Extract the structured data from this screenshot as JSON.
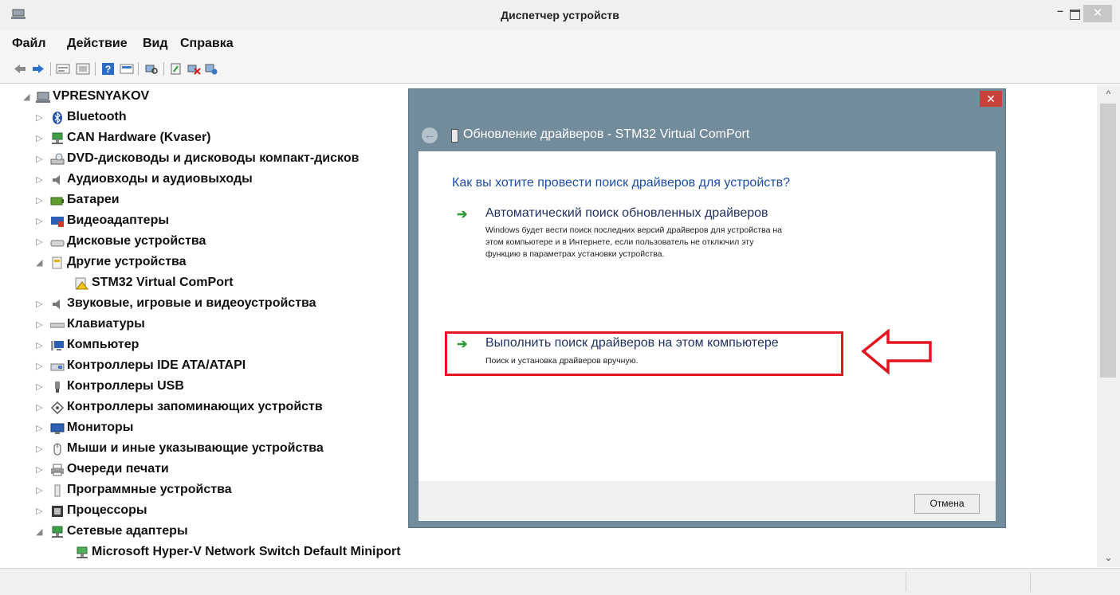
{
  "window": {
    "title": "Диспетчер устройств",
    "close": "✕",
    "minimize": "–"
  },
  "menu": [
    "Файл",
    "Действие",
    "Вид",
    "Справка"
  ],
  "tree": {
    "root": "VPRESNYAKOV",
    "items": [
      "Bluetooth",
      "CAN Hardware (Kvaser)",
      "DVD-дисководы и дисководы компакт-дисков",
      "Аудиовходы и аудиовыходы",
      "Батареи",
      "Видеоадаптеры",
      "Дисковые устройства",
      "Другие устройства",
      "STM32 Virtual ComPort",
      "Звуковые, игровые и видеоустройства",
      "Клавиатуры",
      "Компьютер",
      "Контроллеры IDE ATA/ATAPI",
      "Контроллеры USB",
      "Контроллеры запоминающих устройств",
      "Мониторы",
      "Мыши и иные указывающие устройства",
      "Очереди печати",
      "Программные устройства",
      "Процессоры",
      "Сетевые адаптеры",
      "Microsoft Hyper-V Network Switch Default Miniport"
    ]
  },
  "dialog": {
    "title": "Обновление драйверов - STM32 Virtual ComPort",
    "question": "Как вы хотите провести поиск драйверов для устройств?",
    "option1": {
      "title": "Автоматический поиск обновленных драйверов",
      "desc1": "Windows будет вести поиск последних версий драйверов для устройства на",
      "desc2": "этом компьютере и в Интернете, если пользователь не отключил эту",
      "desc3": "функцию в параметрах установки устройства."
    },
    "option2": {
      "title": "Выполнить поиск драйверов на этом компьютере",
      "desc": "Поиск и установка драйверов вручную."
    },
    "cancel": "Отмена",
    "close": "✕"
  },
  "colors": {
    "highlight": "#e3141f",
    "link": "#1a4da8",
    "dialog_frame": "#738c9c",
    "arrow_green": "#2e9b36"
  }
}
